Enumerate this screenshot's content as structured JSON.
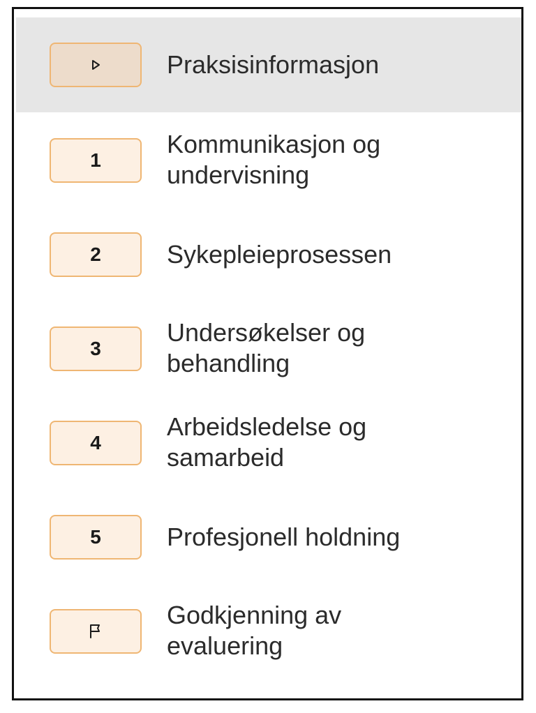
{
  "steps": [
    {
      "badge": "",
      "icon": "play-icon",
      "label": "Praksisinformasjon",
      "active": true
    },
    {
      "badge": "1",
      "label1": "Kommunikasjon og",
      "label2": "undervisning"
    },
    {
      "badge": "2",
      "label": "Sykepleieprosessen"
    },
    {
      "badge": "3",
      "label1": "Undersøkelser og",
      "label2": "behandling"
    },
    {
      "badge": "4",
      "label1": "Arbeidsledelse og",
      "label2": "samarbeid"
    },
    {
      "badge": "5",
      "label": "Profesjonell holdning"
    },
    {
      "badge": "",
      "icon": "flag-icon",
      "label1": "Godkjenning av",
      "label2": "evaluering"
    }
  ],
  "colors": {
    "active_row": "#e6e6e6",
    "badge_border": "#efb673",
    "badge_fill": "#fdf0e3"
  }
}
